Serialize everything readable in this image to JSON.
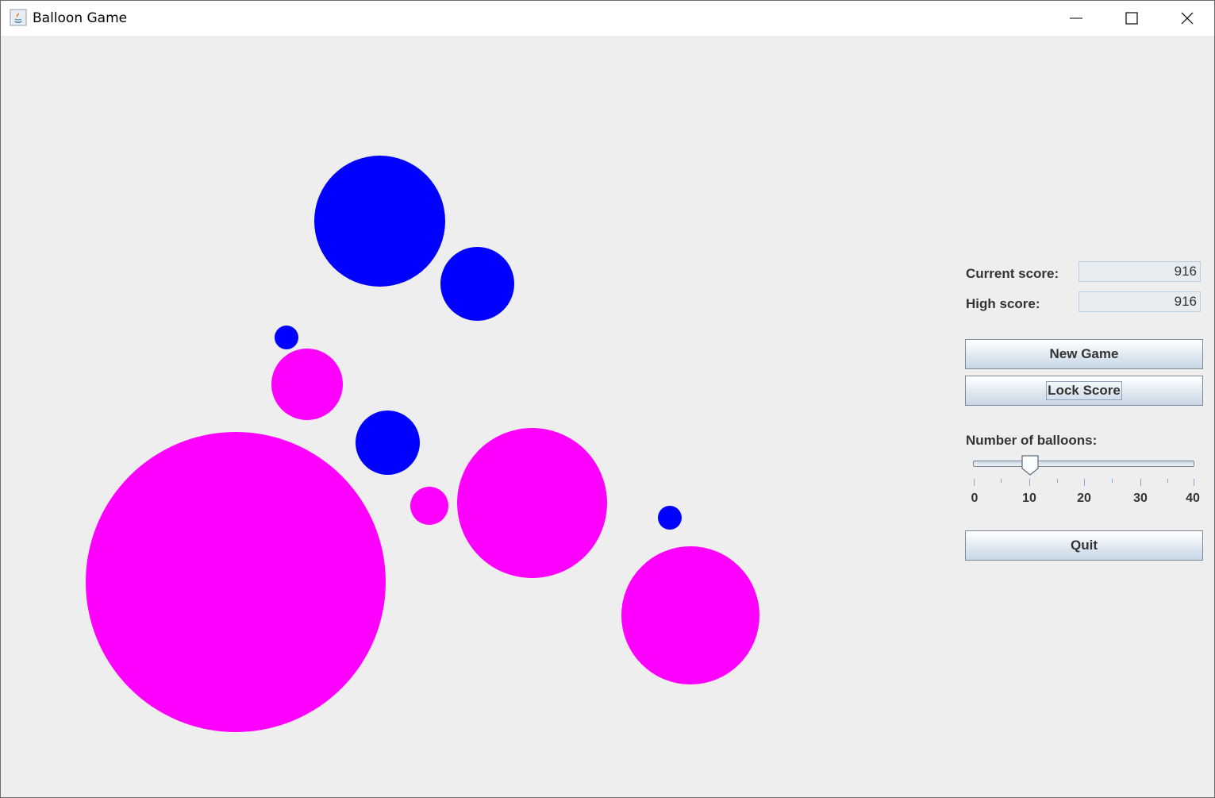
{
  "window": {
    "title": "Balloon Game"
  },
  "balloons": [
    {
      "color": "#0000ff"
    },
    {
      "color": "#0000ff"
    },
    {
      "color": "#0000ff"
    },
    {
      "color": "#ff00ff"
    },
    {
      "color": "#0000ff"
    },
    {
      "color": "#ff00ff"
    },
    {
      "color": "#ff00ff"
    },
    {
      "color": "#ff00ff"
    },
    {
      "color": "#0000ff"
    },
    {
      "color": "#ff00ff"
    }
  ],
  "scores": {
    "current_label": "Current score:",
    "current_value": "916",
    "high_label": "High score:",
    "high_value": "916"
  },
  "buttons": {
    "new_game": "New Game",
    "lock_score": "Lock Score",
    "quit": "Quit"
  },
  "slider": {
    "label": "Number of balloons:",
    "value": 10,
    "min": 0,
    "max": 40,
    "tick_labels": [
      "0",
      "10",
      "20",
      "30",
      "40"
    ]
  }
}
